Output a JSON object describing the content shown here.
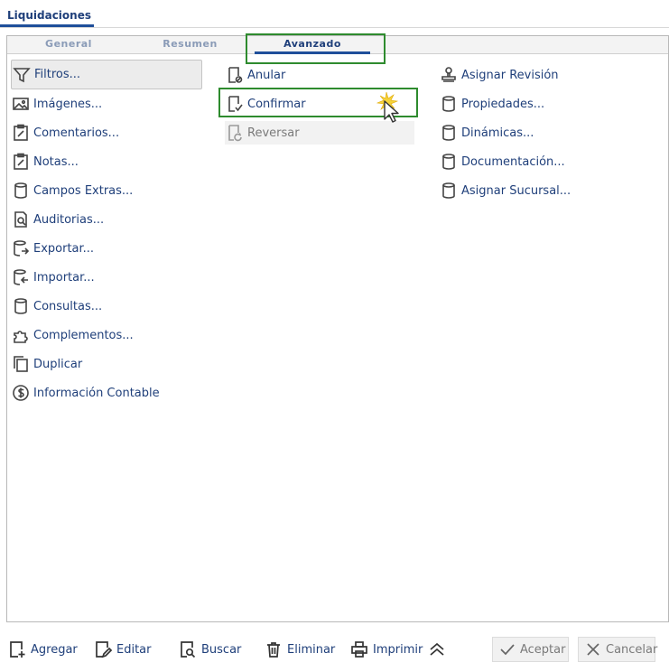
{
  "window": {
    "tab_label": "Liquidaciones"
  },
  "tabs": [
    {
      "label": "General"
    },
    {
      "label": "Resumen"
    },
    {
      "label": "Avanzado"
    }
  ],
  "column1": [
    {
      "label": "Filtros...",
      "icon": "filter-icon"
    },
    {
      "label": "Imágenes...",
      "icon": "image-icon"
    },
    {
      "label": "Comentarios...",
      "icon": "clipboard-edit-icon"
    },
    {
      "label": "Notas...",
      "icon": "clipboard-edit-icon"
    },
    {
      "label": "Campos Extras...",
      "icon": "database-icon"
    },
    {
      "label": "Auditorias...",
      "icon": "document-search-icon"
    },
    {
      "label": "Exportar...",
      "icon": "database-export-icon"
    },
    {
      "label": "Importar...",
      "icon": "database-import-icon"
    },
    {
      "label": "Consultas...",
      "icon": "database-icon"
    },
    {
      "label": "Complementos...",
      "icon": "puzzle-icon"
    },
    {
      "label": "Duplicar",
      "icon": "copy-icon"
    },
    {
      "label": "Información Contable",
      "icon": "dollar-icon"
    }
  ],
  "column2": [
    {
      "label": "Anular",
      "icon": "document-cancel-icon"
    },
    {
      "label": "Confirmar",
      "icon": "document-check-icon"
    },
    {
      "label": "Reversar",
      "icon": "document-undo-icon"
    }
  ],
  "column3": [
    {
      "label": "Asignar Revisión",
      "icon": "stamp-icon"
    },
    {
      "label": "Propiedades...",
      "icon": "database-icon"
    },
    {
      "label": "Dinámicas...",
      "icon": "database-icon"
    },
    {
      "label": "Documentación...",
      "icon": "database-icon"
    },
    {
      "label": "Asignar Sucursal...",
      "icon": "database-icon"
    }
  ],
  "toolbar": {
    "add": "Agregar",
    "edit": "Editar",
    "search": "Buscar",
    "delete": "Eliminar",
    "print": "Imprimir",
    "accept": "Aceptar",
    "cancel": "Cancelar"
  },
  "colors": {
    "accent": "#1f4f9a",
    "highlight": "#2e8b2e",
    "link": "#1f3f7a"
  }
}
